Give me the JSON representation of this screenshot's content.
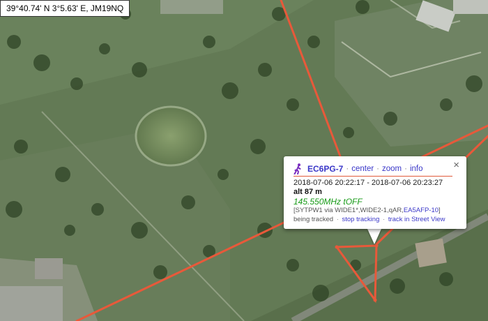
{
  "coordinates": "39°40.74' N 3°5.63' E, JM19NQ",
  "popup": {
    "callsign": "EC6PG-7",
    "links": {
      "center": "center",
      "zoom": "zoom",
      "info": "info"
    },
    "separator": "·",
    "time_range": "2018-07-06 20:22:17 - 2018-07-06 20:23:27",
    "altitude": "alt 87 m",
    "frequency": "145.550MHz tOFF",
    "path_prefix": "[SYTPW1 via WIDE1*,WIDE2-1,qAR,",
    "path_link": "EA5AFP-10",
    "path_suffix": "]",
    "tracking_status": "being tracked",
    "stop_tracking": "stop tracking",
    "street_view": "track in Street View",
    "close_symbol": "×"
  },
  "colors": {
    "track": "#e8593a",
    "link": "#3a37c8",
    "frequency": "#169a16",
    "satellite_base": "#59704a"
  },
  "icons": {
    "station_icon": "walker-icon",
    "close_icon": "close-icon"
  }
}
